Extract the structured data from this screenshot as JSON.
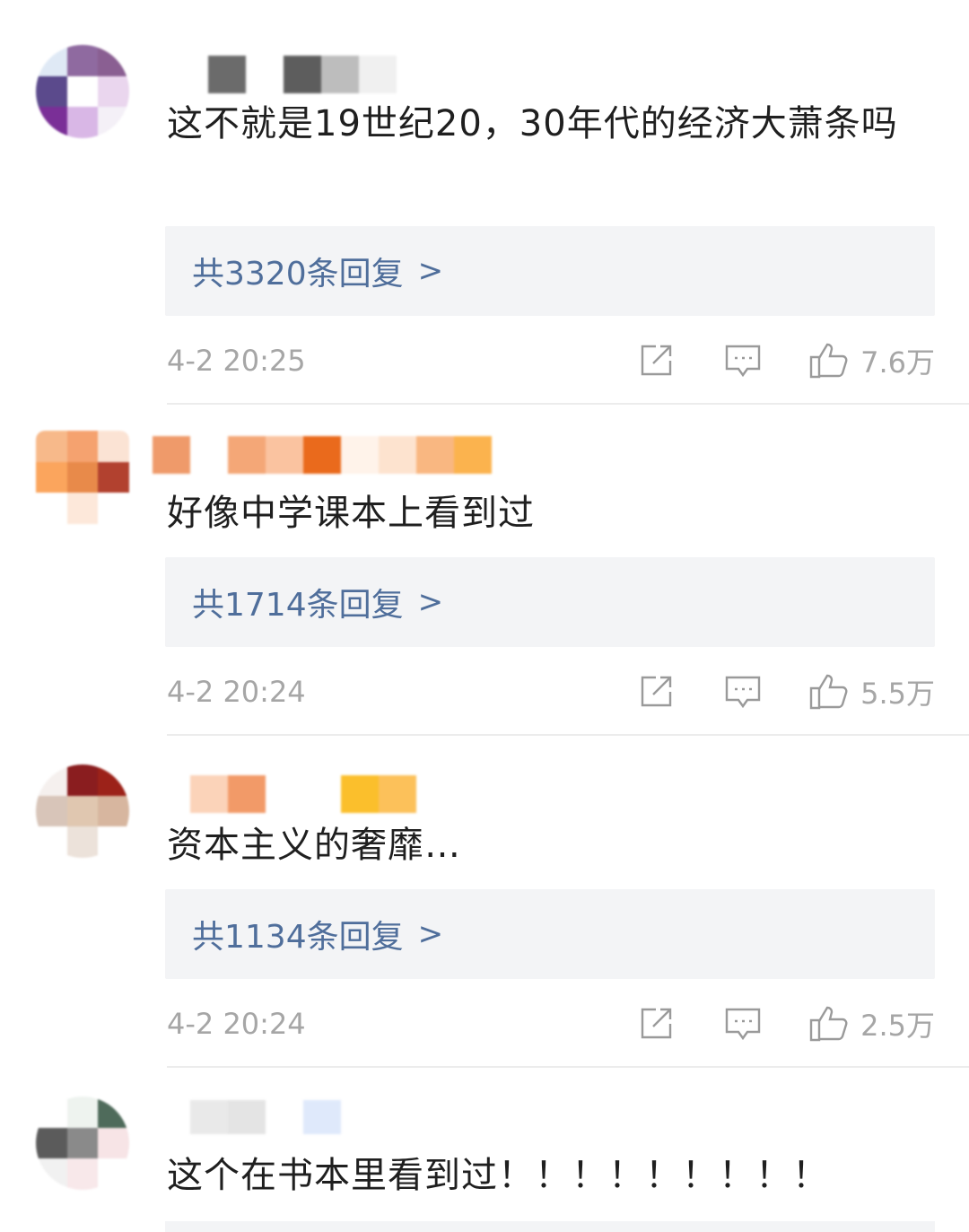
{
  "comments": [
    {
      "avatar_colors": [
        "#dfe9f5",
        "#8f6aa0",
        "#8a5f92",
        "#5b4a8c",
        "#ffffff",
        "#ead6ee",
        "#7a2f97",
        "#d9b7e6",
        "#f4f0f7"
      ],
      "name_colors": [
        "#ffffff",
        "#6b6b6b",
        "#ffffff",
        "#5d5d5d",
        "#bdbdbd",
        "#f0f0f0"
      ],
      "text": "这不就是19世纪20，30年代的经济大萧条吗",
      "replies_label": "共3320条回复",
      "time": "4-2 20:25",
      "likes": "7.6万"
    },
    {
      "avatar_colors": [
        "#f7b98a",
        "#f5a26f",
        "#fbe3d4",
        "#fba55d",
        "#e88a4a",
        "#b2412f",
        "#ffffff",
        "#fde8da",
        "#ffffff"
      ],
      "name_colors": [
        "#ef9a6a",
        "#ffffff",
        "#f4a777",
        "#fac3a0",
        "#ea6a1c",
        "#fff3ea",
        "#fde3cf",
        "#f9b781",
        "#fbb34e"
      ],
      "text": "好像中学课本上看到过",
      "replies_label": "共1714条回复",
      "time": "4-2 20:24",
      "likes": "5.5万"
    },
    {
      "avatar_colors": [
        "#f5f0ee",
        "#8a1d1f",
        "#9c2219",
        "#d8c5b9",
        "#e0c7b0",
        "#d7b69f",
        "#ffffff",
        "#ece2da",
        "#ffffff"
      ],
      "name_colors": [
        "#ffffff",
        "#fbd3b9",
        "#f29a68",
        "#ffffff",
        "#ffffff",
        "#fbbf2c",
        "#fcc15a"
      ],
      "text": "资本主义的奢靡…",
      "replies_label": "共1134条回复",
      "time": "4-2 20:24",
      "likes": "2.5万"
    },
    {
      "avatar_colors": [
        "#ffffff",
        "#eef3ef",
        "#4f6b5b",
        "#5b5b5b",
        "#8a8a8a",
        "#f7e4e6",
        "#f1f1f1",
        "#f8e8ea",
        "#ffffff"
      ],
      "name_colors": [
        "#ffffff",
        "#e9e9e9",
        "#e4e4e4",
        "#ffffff",
        "#dfe9fb"
      ],
      "text": "这个在书本里看到过！！！！！！！！！",
      "replies_label": "",
      "time": "",
      "likes": ""
    }
  ],
  "icons": {
    "share": "share-icon",
    "comment": "comment-icon",
    "like": "thumbs-up-icon",
    "chevron": ">"
  },
  "colors": {
    "link": "#4f6e9b",
    "muted": "#a6a6a6",
    "reply_bg": "#f3f4f6"
  }
}
